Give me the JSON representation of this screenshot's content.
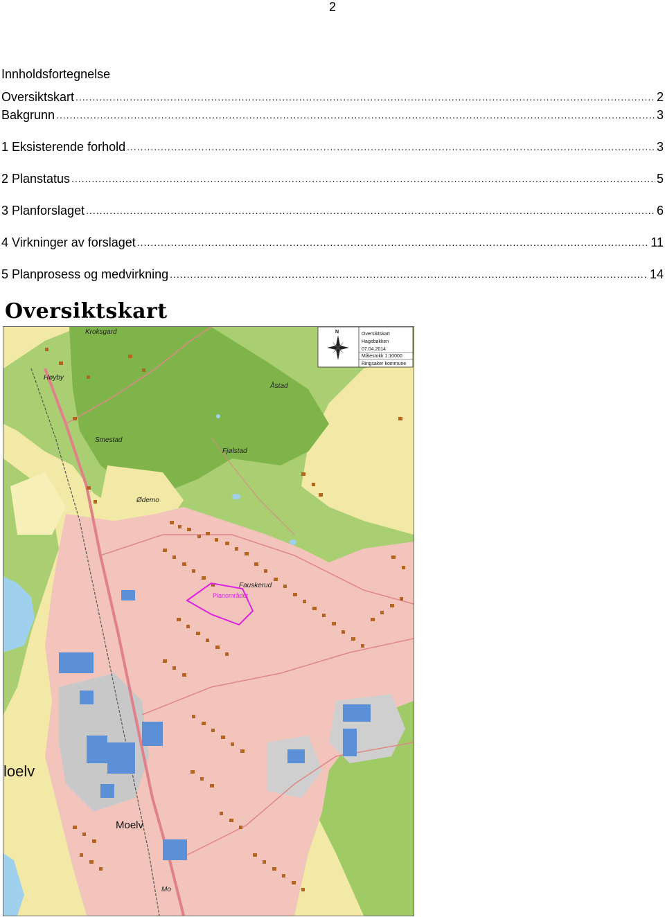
{
  "page_number": "2",
  "toc": {
    "heading": "Innholdsfortegnelse",
    "entries": [
      {
        "label": "Oversiktskart",
        "page": "2"
      },
      {
        "label": "Bakgrunn",
        "page": "3"
      },
      {
        "label": "1 Eksisterende forhold",
        "page": "3"
      },
      {
        "label": "2 Planstatus",
        "page": "5"
      },
      {
        "label": "3 Planforslaget",
        "page": "6"
      },
      {
        "label": "4 Virkninger av forslaget",
        "page": "11"
      },
      {
        "label": "5 Planprosess og medvirkning",
        "page": "14"
      }
    ]
  },
  "section_title": "Oversiktskart",
  "map": {
    "legend": {
      "north": "N",
      "lines": [
        "Oversiktskart",
        "Hagebakken",
        "07.04.2014",
        "Målestokk 1:10000",
        "Ringsaker kommune"
      ]
    },
    "places": {
      "kroksgard": "Kroksgard",
      "hoyby": "Høyby",
      "astad": "Åstad",
      "smestad": "Smestad",
      "fjolstad": "Fjølstad",
      "odemo": "Ødemo",
      "fauskerud": "Fauskerud",
      "planomrade": "Planområdet",
      "moelv_big": "loelv",
      "moelv": "Moelv",
      "mo": "Mo"
    },
    "colors": {
      "forest": "#8fbf5a",
      "open_land": "#f2e9a6",
      "residential": "#f3c4bc",
      "industrial": "#c8c8c8",
      "lake": "#9fd1ee",
      "building": "#b5651d",
      "industrial_building": "#5b8fd6",
      "plan_boundary": "#e020e0"
    }
  }
}
